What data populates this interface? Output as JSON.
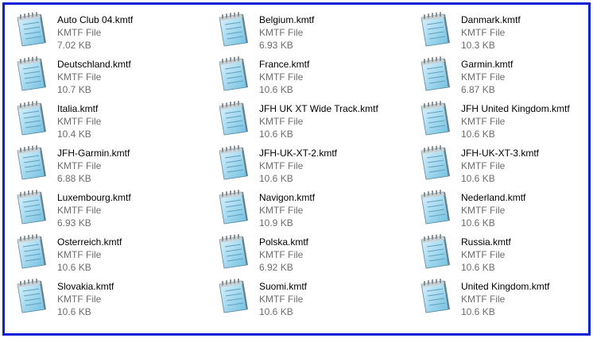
{
  "files": [
    {
      "name": "Auto Club 04.kmtf",
      "type": "KMTF File",
      "size": "7.02 KB"
    },
    {
      "name": "Belgium.kmtf",
      "type": "KMTF File",
      "size": "6.93 KB"
    },
    {
      "name": "Danmark.kmtf",
      "type": "KMTF File",
      "size": "10.3 KB"
    },
    {
      "name": "Deutschland.kmtf",
      "type": "KMTF File",
      "size": "10.7 KB"
    },
    {
      "name": "France.kmtf",
      "type": "KMTF File",
      "size": "10.6 KB"
    },
    {
      "name": "Garmin.kmtf",
      "type": "KMTF File",
      "size": "6.87 KB"
    },
    {
      "name": "Italia.kmtf",
      "type": "KMTF File",
      "size": "10.4 KB"
    },
    {
      "name": "JFH UK XT Wide Track.kmtf",
      "type": "KMTF File",
      "size": "10.6 KB"
    },
    {
      "name": "JFH United Kingdom.kmtf",
      "type": "KMTF File",
      "size": "10.6 KB"
    },
    {
      "name": "JFH-Garmin.kmtf",
      "type": "KMTF File",
      "size": "6.88 KB"
    },
    {
      "name": "JFH-UK-XT-2.kmtf",
      "type": "KMTF File",
      "size": "10.6 KB"
    },
    {
      "name": "JFH-UK-XT-3.kmtf",
      "type": "KMTF File",
      "size": "10.6 KB"
    },
    {
      "name": "Luxembourg.kmtf",
      "type": "KMTF File",
      "size": "6.93 KB"
    },
    {
      "name": "Navigon.kmtf",
      "type": "KMTF File",
      "size": "10.9 KB"
    },
    {
      "name": "Nederland.kmtf",
      "type": "KMTF File",
      "size": "10.6 KB"
    },
    {
      "name": "Osterreich.kmtf",
      "type": "KMTF File",
      "size": "10.6 KB"
    },
    {
      "name": "Polska.kmtf",
      "type": "KMTF File",
      "size": "6.92 KB"
    },
    {
      "name": "Russia.kmtf",
      "type": "KMTF File",
      "size": "10.6 KB"
    },
    {
      "name": "Slovakia.kmtf",
      "type": "KMTF File",
      "size": "10.6 KB"
    },
    {
      "name": "Suomi.kmtf",
      "type": "KMTF File",
      "size": "10.6 KB"
    },
    {
      "name": "United Kingdom.kmtf",
      "type": "KMTF File",
      "size": "10.6 KB"
    }
  ],
  "icon": "notepad-document-icon",
  "colors": {
    "frame_border": "#0b1fd6",
    "secondary_text": "#6d6d6d",
    "icon_body": "#a9dbf0"
  }
}
